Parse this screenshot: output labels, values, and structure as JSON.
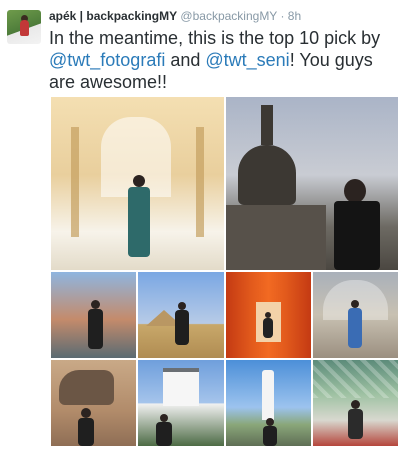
{
  "tweet": {
    "author_name": "apék | backpackingMY",
    "author_handle": "@backpackingMY",
    "separator": "·",
    "time": "8h",
    "text_parts": {
      "p1": "In the meantime, this is the top 10 pick by ",
      "mention1": "@twt_fotografi",
      "p2": " and ",
      "mention2": "@twt_seni",
      "p3": "!  You guys are awesome!!"
    },
    "colors": {
      "name": "#292f33",
      "meta": "#8899a6",
      "mention": "#2b7bb9"
    }
  },
  "photos": [
    {
      "id": "alhambra-palace"
    },
    {
      "id": "borobudur-stupas"
    },
    {
      "id": "venice-canal"
    },
    {
      "id": "giza-pyramids"
    },
    {
      "id": "fushimi-inari-torii"
    },
    {
      "id": "natural-history-museum"
    },
    {
      "id": "sculpture-horse"
    },
    {
      "id": "himeji-castle"
    },
    {
      "id": "lighthouse"
    },
    {
      "id": "glass-roof-atrium"
    }
  ]
}
